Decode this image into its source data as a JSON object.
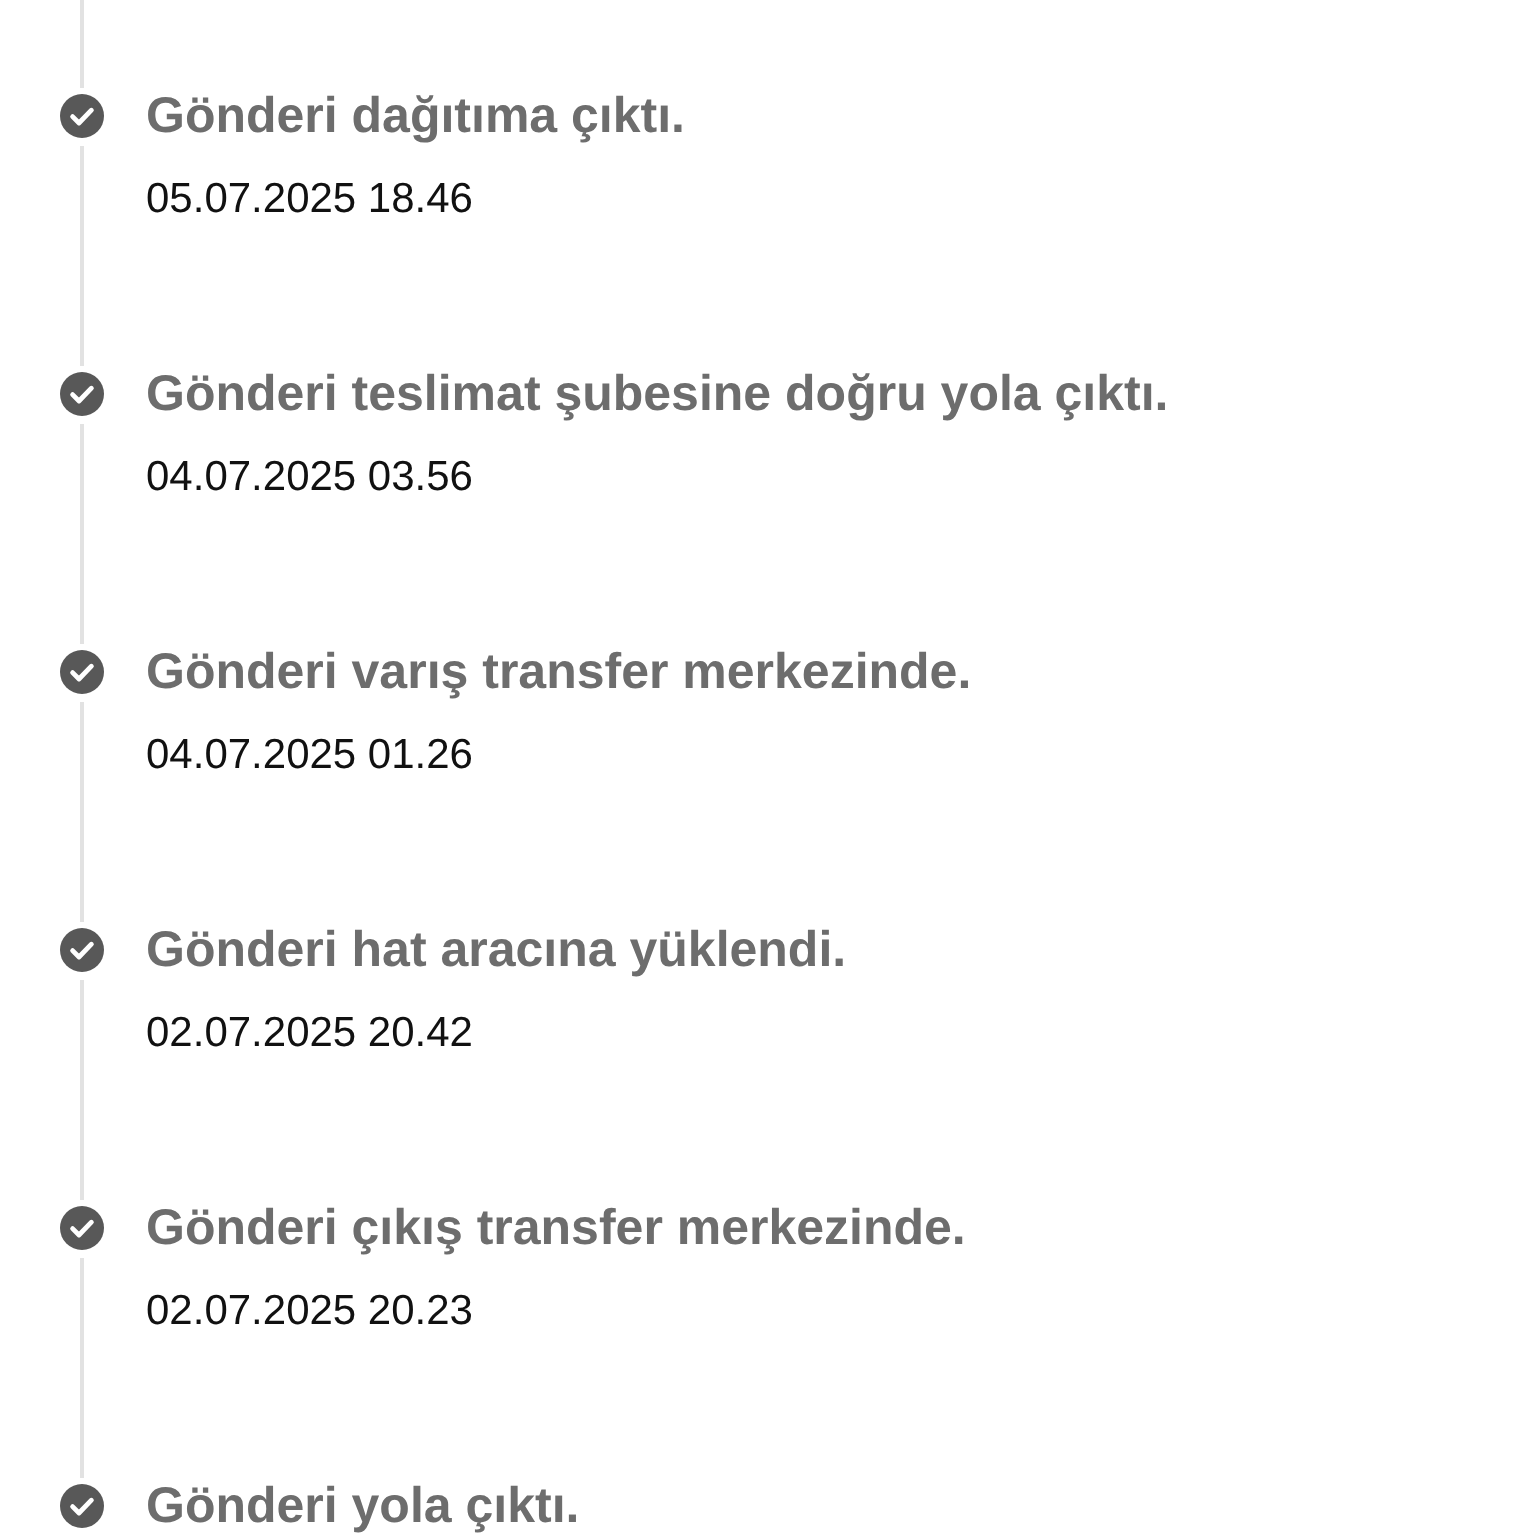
{
  "events": [
    {
      "title": "Gönderi dağıtıma çıktı.",
      "date": "05.07.2025 18.46",
      "completed": true
    },
    {
      "title": "Gönderi teslimat şubesine doğru yola çıktı.",
      "date": "04.07.2025 03.56",
      "completed": true
    },
    {
      "title": "Gönderi varış transfer merkezinde.",
      "date": "04.07.2025 01.26",
      "completed": true
    },
    {
      "title": "Gönderi hat aracına yüklendi.",
      "date": "02.07.2025 20.42",
      "completed": true
    },
    {
      "title": "Gönderi çıkış transfer merkezinde.",
      "date": "02.07.2025 20.23",
      "completed": true
    },
    {
      "title": "Gönderi yola çıktı.",
      "completed": true
    }
  ]
}
